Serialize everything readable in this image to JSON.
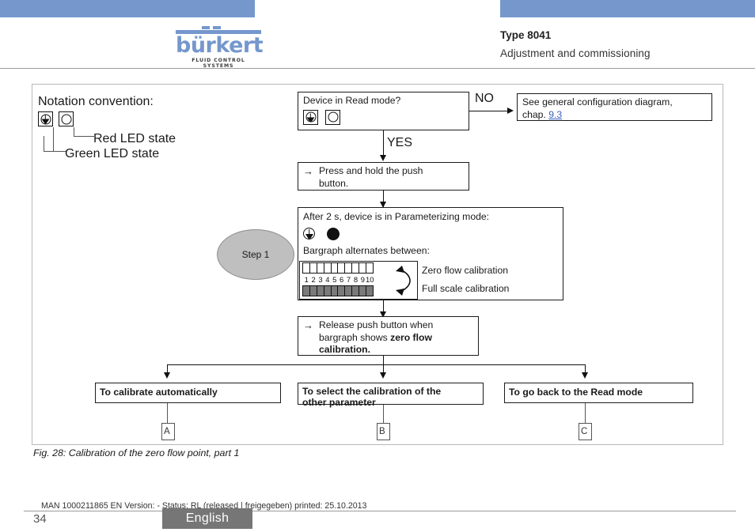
{
  "header": {
    "logo_word": "bürkert",
    "logo_sub": "FLUID CONTROL SYSTEMS",
    "type_title": "Type 8041",
    "subtitle": "Adjustment and commissioning"
  },
  "diagram": {
    "notation": {
      "title": "Notation convention:",
      "red_label": "Red LED state",
      "green_label": "Green LED state"
    },
    "decision": {
      "question": "Device in Read mode?",
      "branch_no": "NO",
      "branch_yes": "YES"
    },
    "ref_box": {
      "text": "See general configuration diagram,",
      "text2": "chap. ",
      "link": "9.3"
    },
    "press_box": {
      "line1": "Press and hold the push",
      "line2": "button."
    },
    "step_label": "Step 1",
    "param_box": {
      "title": "After 2 s, device is in Parameterizing mode:",
      "bargraph_title": "Bargraph alternates between:",
      "bargraph_numbers": [
        "1",
        "2",
        "3",
        "4",
        "5",
        "6",
        "7",
        "8",
        "9",
        "10"
      ],
      "alt_top": "Zero flow calibration",
      "alt_bottom": "Full scale calibration"
    },
    "release_box": {
      "line1": "Release push button when",
      "line2": "bargraph shows ",
      "bold2": "zero flow",
      "bold3": "calibration."
    },
    "outcomes": [
      {
        "label": "To calibrate automatically",
        "connector": "A"
      },
      {
        "label_line1": "To select the calibration of the",
        "label_line2": "other parameter",
        "connector": "B"
      },
      {
        "label": "To go back to the Read mode",
        "connector": "C"
      }
    ]
  },
  "caption": "Fig. 28:  Calibration of the zero flow point, part 1",
  "footer": {
    "meta": "MAN 1000211865 EN Version: - Status: RL (released | freigegeben) printed: 25.10.2013",
    "page": "34",
    "language": "English"
  },
  "colors": {
    "brand_blue": "#7597cc",
    "link_blue": "#3a5fc0",
    "bargraph_fill": "#7a7a7a",
    "step_ellipse": "#bfbfbf",
    "lang_badge": "#767676"
  }
}
